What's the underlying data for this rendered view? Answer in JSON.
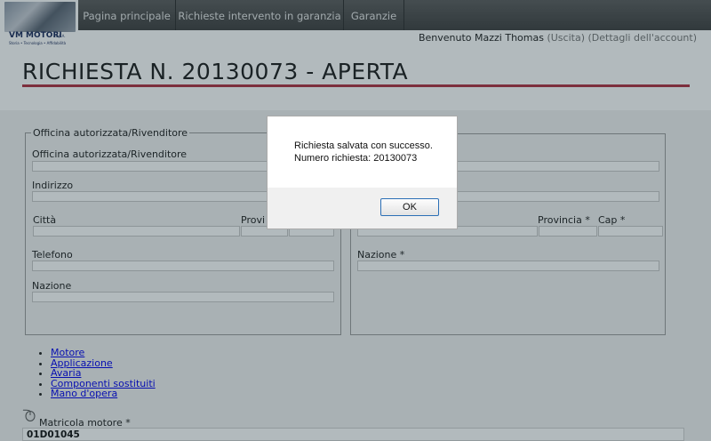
{
  "logo": {
    "brand": "VM MOTORI",
    "brand_suffix": "S.p.A.",
    "tagline": "Storia • Tecnologia • Affidabilità"
  },
  "nav": [
    {
      "label": "Pagina principale"
    },
    {
      "label": "Richieste intervento in garanzia"
    },
    {
      "label": "Garanzie"
    }
  ],
  "user": {
    "welcome": "Benvenuto Mazzi Thomas",
    "logout": "(Uscita)",
    "account": "(Dettagli dell'account)"
  },
  "page_title": "RICHIESTA N. 20130073 - APERTA",
  "left_fieldset": {
    "legend": "Officina autorizzata/Rivenditore",
    "officina_label": "Officina autorizzata/Rivenditore",
    "indirizzo_label": "Indirizzo",
    "citta_label": "Città",
    "provincia_label": "Provi",
    "telefono_label": "Telefono",
    "nazione_label": "Nazione"
  },
  "right_fieldset": {
    "provincia_label": "Provincia *",
    "cap_label": "Cap *",
    "nazione_label": "Nazione *"
  },
  "links": [
    "Motore",
    "Applicazione",
    "Avaria",
    "Componenti sostituiti",
    "Mano d'opera"
  ],
  "matricola": {
    "label": "Matricola motore *",
    "value": "01D01045"
  },
  "dialog": {
    "line1": "Richiesta salvata con successo.",
    "line2": "Numero richiesta: 20130073",
    "ok_label": "OK"
  }
}
